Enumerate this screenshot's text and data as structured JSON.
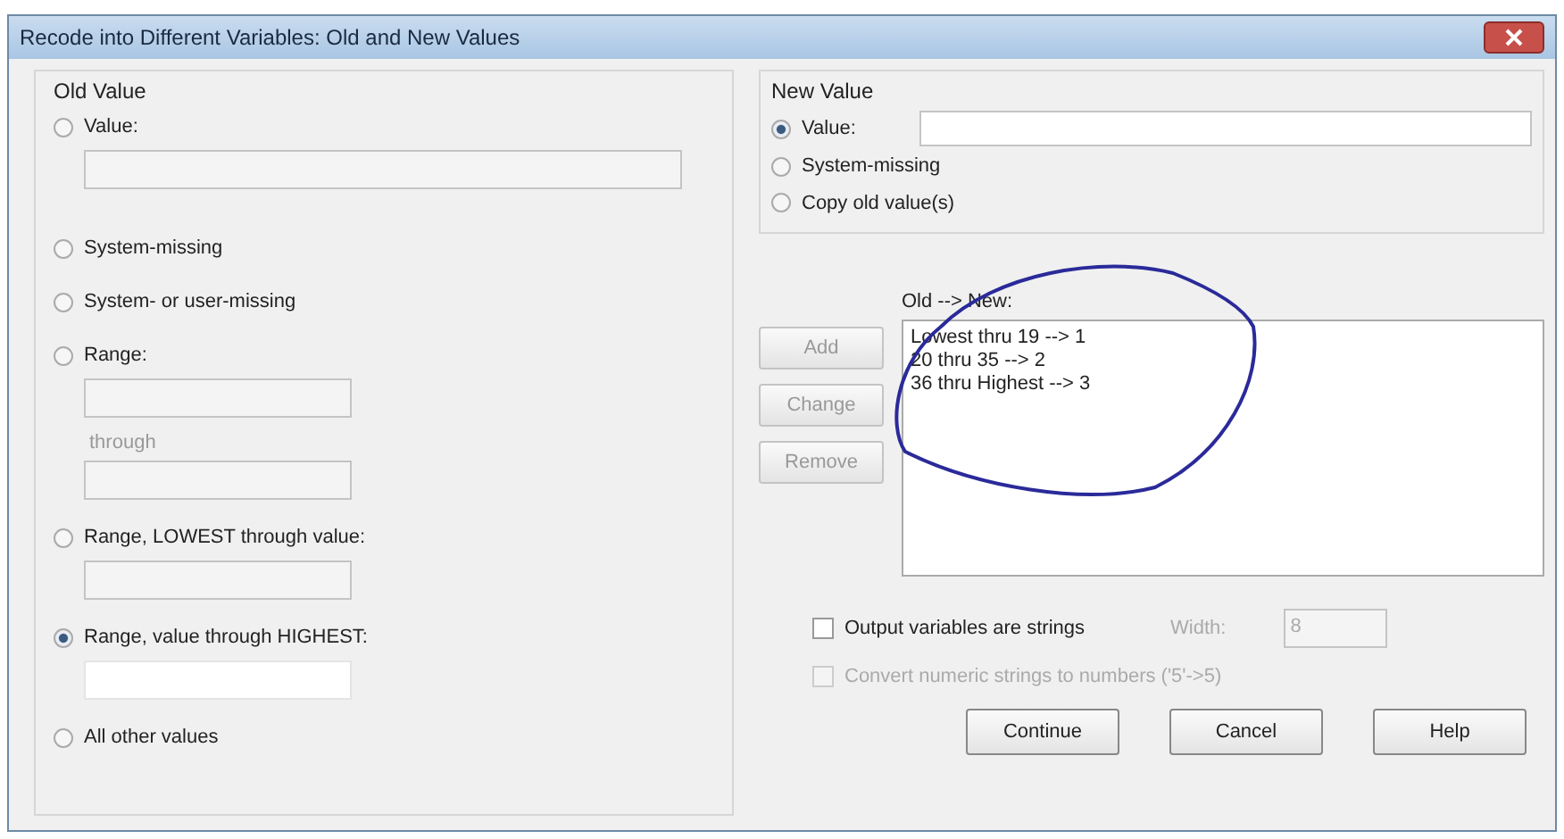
{
  "window": {
    "title": "Recode into Different Variables: Old and New Values"
  },
  "old_value": {
    "title": "Old Value",
    "options": [
      {
        "label": "Value:",
        "selected": false,
        "kind": "wide"
      },
      {
        "label": "System-missing",
        "selected": false,
        "kind": "plain"
      },
      {
        "label": "System- or user-missing",
        "selected": false,
        "kind": "plain"
      },
      {
        "label": "Range:",
        "selected": false,
        "kind": "range",
        "through": "through"
      },
      {
        "label": "Range, LOWEST through value:",
        "selected": false,
        "kind": "field"
      },
      {
        "label": "Range, value through HIGHEST:",
        "selected": true,
        "kind": "field"
      },
      {
        "label": "All other values",
        "selected": false,
        "kind": "plain"
      }
    ]
  },
  "new_value": {
    "title": "New Value",
    "options": [
      {
        "label": "Value:",
        "selected": true,
        "kind": "field"
      },
      {
        "label": "System-missing",
        "selected": false,
        "kind": "plain"
      },
      {
        "label": "Copy old value(s)",
        "selected": false,
        "kind": "plain"
      }
    ]
  },
  "mapping": {
    "label": "Old --> New:",
    "items": [
      "Lowest thru 19 --> 1",
      "20 thru 35 --> 2",
      "36 thru Highest --> 3"
    ],
    "buttons": [
      {
        "label": "Add",
        "disabled": true
      },
      {
        "label": "Change",
        "disabled": true
      },
      {
        "label": "Remove",
        "disabled": true
      }
    ]
  },
  "checkboxes": [
    {
      "label": "Output variables are strings",
      "checked": false,
      "disabled": false
    },
    {
      "label": "Convert numeric strings to numbers ('5'->5)",
      "checked": false,
      "disabled": true
    }
  ],
  "width": {
    "label": "Width:",
    "value": "8",
    "disabled": true
  },
  "footer_buttons": [
    "Continue",
    "Cancel",
    "Help"
  ]
}
